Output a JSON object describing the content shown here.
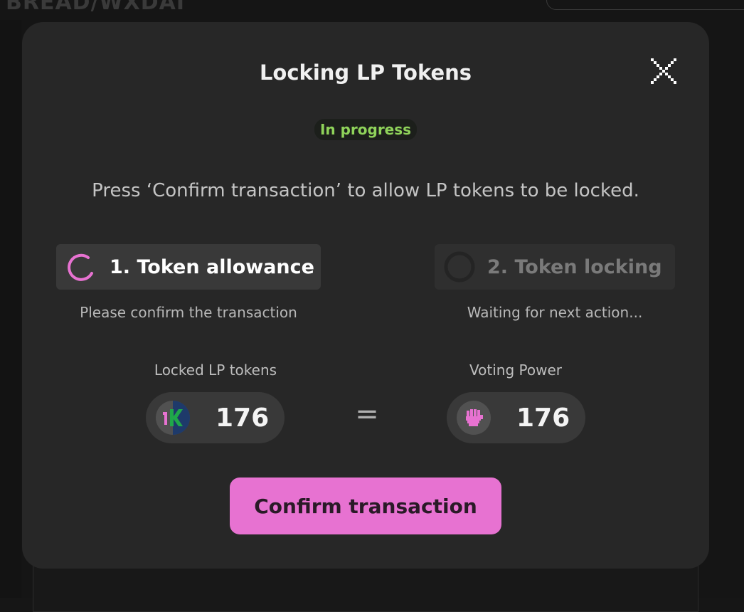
{
  "modal": {
    "title": "Locking LP Tokens",
    "status": "In progress",
    "instruction": "Press ‘Confirm transaction’ to allow LP tokens to be locked.",
    "close_icon": "close-icon"
  },
  "steps": [
    {
      "label": "1. Token allowance",
      "sub": "Please confirm the transaction",
      "icon": "spinner-icon",
      "active": true
    },
    {
      "label": "2. Token locking",
      "sub": "Waiting for next action...",
      "icon": "pending-circle-icon",
      "active": false
    }
  ],
  "stats": {
    "locked": {
      "label": "Locked LP tokens",
      "value": "176",
      "icon": "lp-token-icon"
    },
    "equals": "=",
    "voting": {
      "label": "Voting Power",
      "value": "176",
      "icon": "fist-icon"
    }
  },
  "confirm_button": {
    "label": "Confirm transaction"
  },
  "colors": {
    "accent": "#e772d1",
    "status_green": "#8fd35a",
    "modal_bg": "#272727"
  }
}
